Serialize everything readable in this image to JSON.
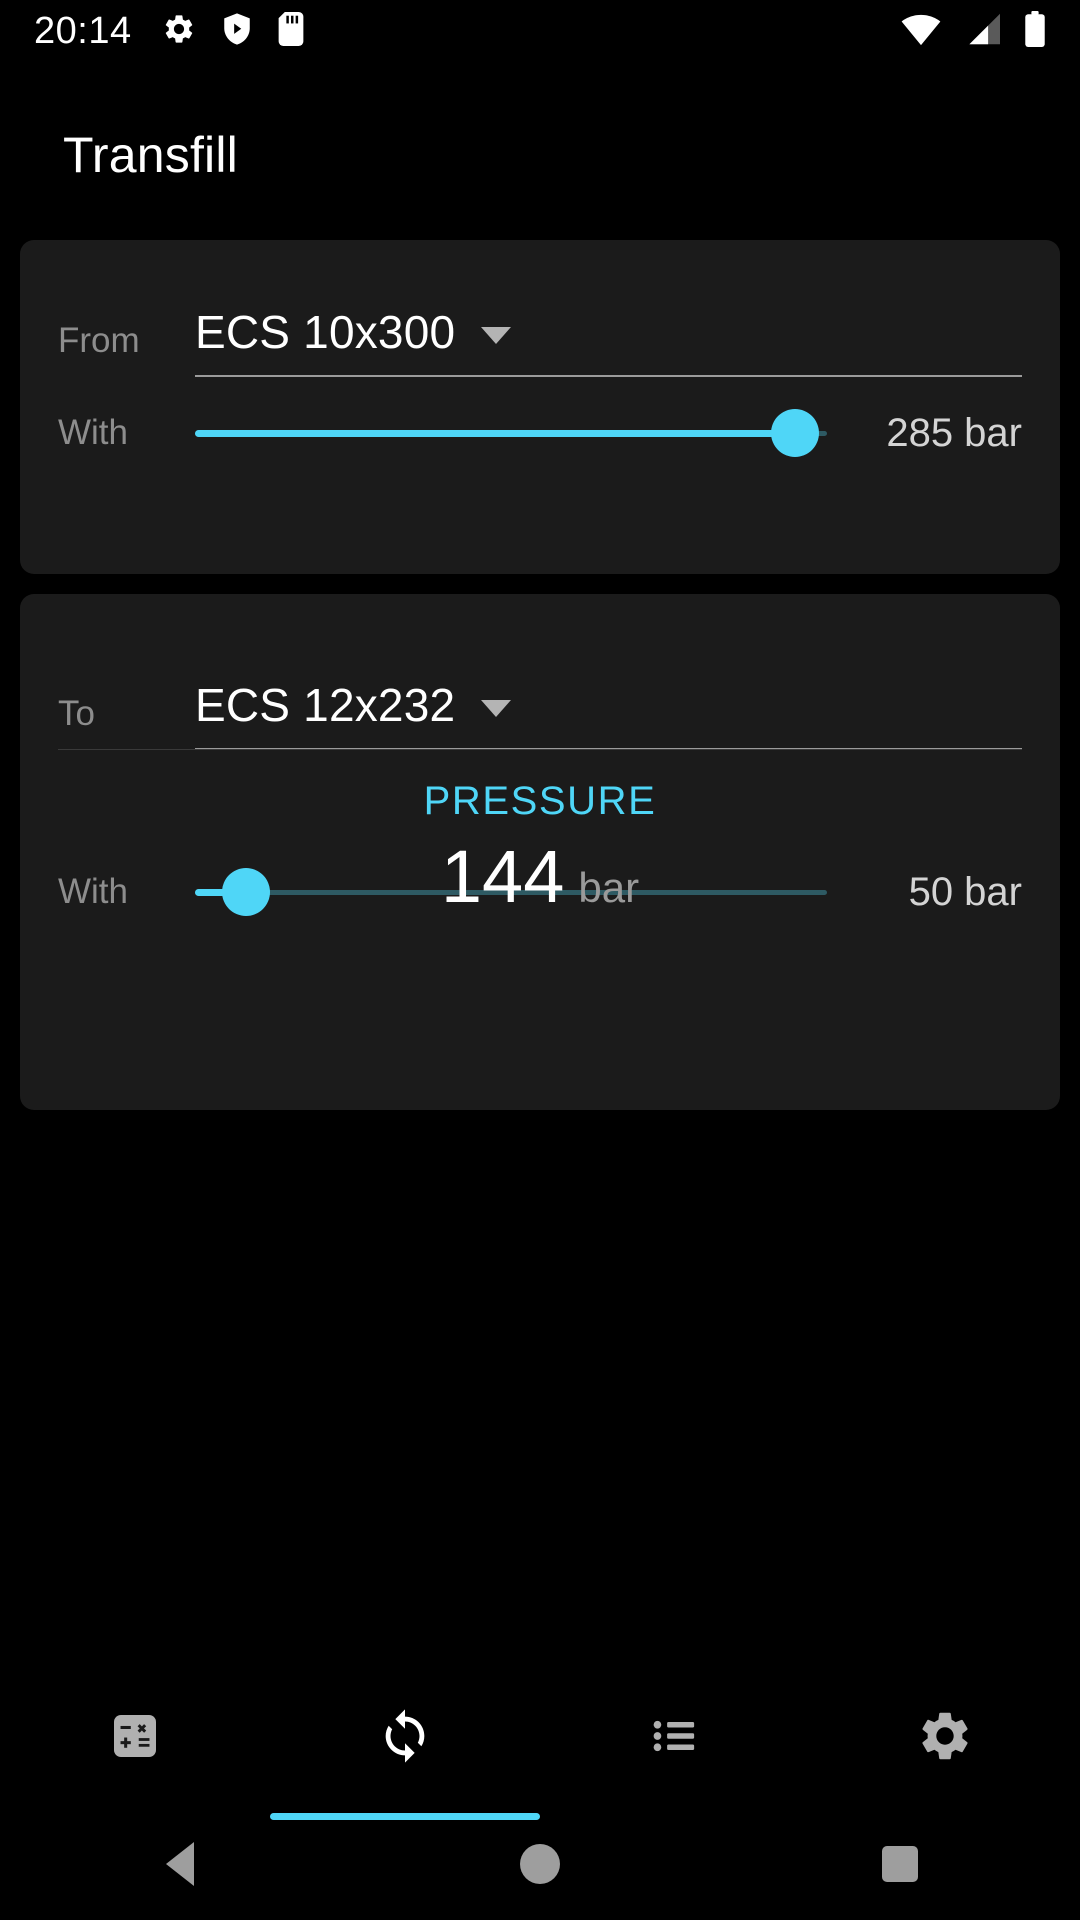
{
  "status_bar": {
    "time": "20:14",
    "left_icons": [
      "gear-icon",
      "shield-play-icon",
      "sd-card-icon"
    ],
    "right_icons": [
      "wifi-icon",
      "cellular-signal-icon",
      "battery-icon"
    ]
  },
  "header": {
    "title": "Transfill"
  },
  "from_card": {
    "label": "From",
    "cylinder": "ECS 10x300",
    "slider_label": "With",
    "slider_value": "285 bar",
    "slider_number": 285,
    "slider_min": 0,
    "slider_max": 300,
    "slider_percent": 95
  },
  "to_card": {
    "label": "To",
    "cylinder": "ECS 12x232",
    "slider_label": "With",
    "slider_value": "50 bar",
    "slider_number": 50,
    "slider_min": 0,
    "slider_max": 232,
    "slider_percent": 8,
    "result_label": "PRESSURE",
    "result_value": "144",
    "result_unit": "bar"
  },
  "tabs": [
    {
      "name": "calculator",
      "icon": "calculator-icon",
      "active": false
    },
    {
      "name": "transfill",
      "icon": "sync-icon",
      "active": true
    },
    {
      "name": "list",
      "icon": "list-icon",
      "active": false
    },
    {
      "name": "settings",
      "icon": "gear-icon",
      "active": false
    }
  ],
  "nav_bar": {
    "back": "back-triangle-icon",
    "home": "home-circle-icon",
    "recents": "recents-square-icon"
  },
  "colors": {
    "accent": "#4fd6f7",
    "background": "#000000",
    "card": "#1b1b1b",
    "label": "#8d8d8d",
    "value": "#ffffff"
  }
}
